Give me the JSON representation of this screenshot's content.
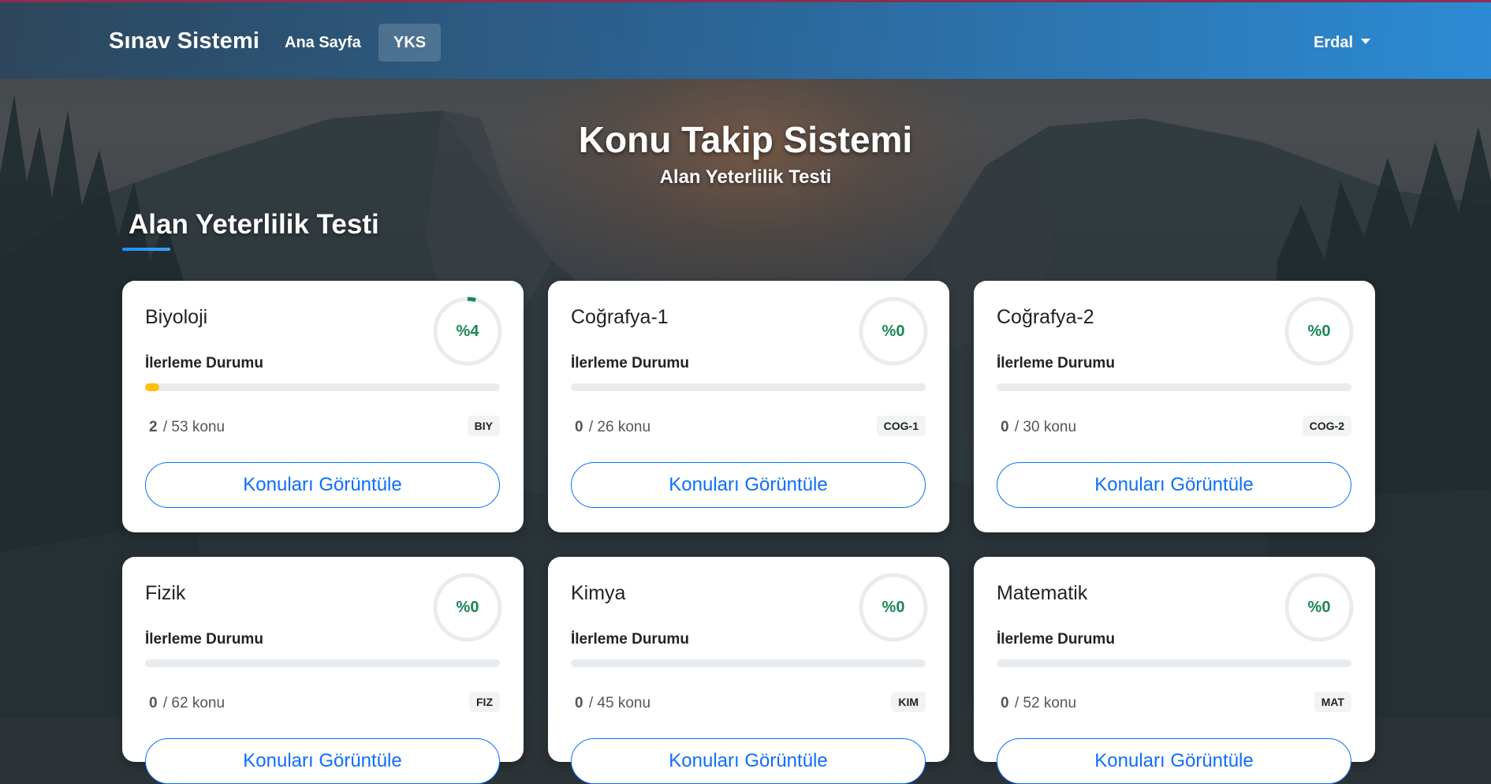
{
  "navbar": {
    "brand": "Sınav Sistemi",
    "links": [
      {
        "label": "Ana Sayfa",
        "active": false
      },
      {
        "label": "YKS",
        "active": true
      }
    ],
    "user": "Erdal"
  },
  "hero": {
    "title": "Konu Takip Sistemi",
    "subtitle": "Alan Yeterlilik Testi"
  },
  "section": {
    "title": "Alan Yeterlilik Testi"
  },
  "colors": {
    "accent": "#0d6efd",
    "success": "#198754",
    "progress": "#ffc107"
  },
  "cards": [
    {
      "name": "Biyoloji",
      "percent_label": "%4",
      "percent": 4,
      "progress_label": "İlerleme Durumu",
      "done": "2",
      "total_text": "/ 53 konu",
      "code": "BIY",
      "button": "Konuları Görüntüle"
    },
    {
      "name": "Coğrafya-1",
      "percent_label": "%0",
      "percent": 0,
      "progress_label": "İlerleme Durumu",
      "done": "0",
      "total_text": "/ 26 konu",
      "code": "COG-1",
      "button": "Konuları Görüntüle"
    },
    {
      "name": "Coğrafya-2",
      "percent_label": "%0",
      "percent": 0,
      "progress_label": "İlerleme Durumu",
      "done": "0",
      "total_text": "/ 30 konu",
      "code": "COG-2",
      "button": "Konuları Görüntüle"
    },
    {
      "name": "Fizik",
      "percent_label": "%0",
      "percent": 0,
      "progress_label": "İlerleme Durumu",
      "done": "0",
      "total_text": "/ 62 konu",
      "code": "FIZ",
      "button": "Konuları Görüntüle"
    },
    {
      "name": "Kimya",
      "percent_label": "%0",
      "percent": 0,
      "progress_label": "İlerleme Durumu",
      "done": "0",
      "total_text": "/ 45 konu",
      "code": "KIM",
      "button": "Konuları Görüntüle"
    },
    {
      "name": "Matematik",
      "percent_label": "%0",
      "percent": 0,
      "progress_label": "İlerleme Durumu",
      "done": "0",
      "total_text": "/ 52 konu",
      "code": "MAT",
      "button": "Konuları Görüntüle"
    }
  ]
}
